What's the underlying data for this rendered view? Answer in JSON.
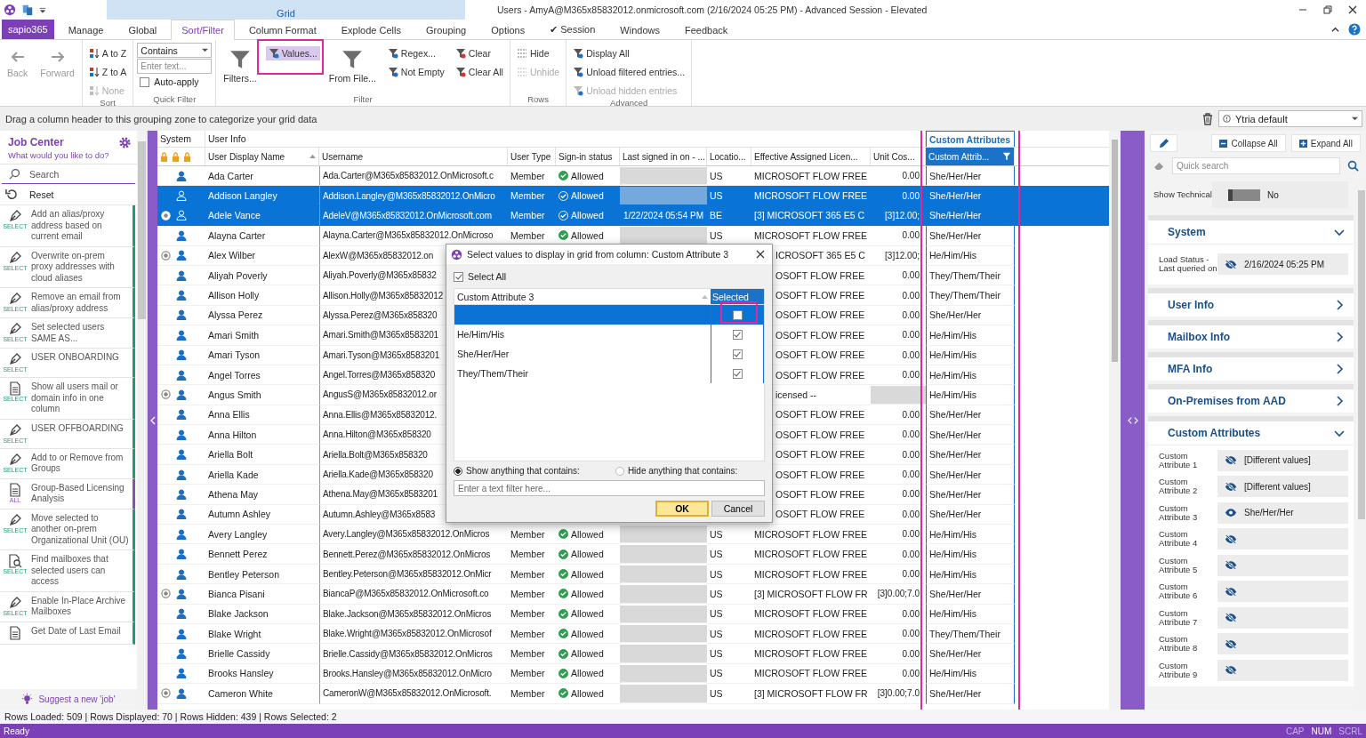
{
  "title_bar": {
    "context_tab": "Grid",
    "title": "Users - AmyA@M365x85832012.onmicrosoft.com (2/16/2024 05:25 PM) - Advanced Session - Elevated"
  },
  "menu": {
    "app_button": "sapio365",
    "tabs": [
      {
        "label": "Manage",
        "selected": false
      },
      {
        "label": "Global",
        "selected": false
      },
      {
        "label": "Sort/Filter",
        "selected": true
      },
      {
        "label": "Column Format",
        "selected": false
      },
      {
        "label": "Explode Cells",
        "selected": false
      },
      {
        "label": "Grouping",
        "selected": false
      },
      {
        "label": "Options",
        "selected": false
      },
      {
        "label": "✔ Session",
        "selected": false
      },
      {
        "label": "Windows",
        "selected": false
      },
      {
        "label": "Feedback",
        "selected": false
      }
    ]
  },
  "ribbon": {
    "groups": [
      {
        "columns": [
          [
            {
              "kind": "large",
              "label": "Back",
              "disabled": true
            }
          ],
          [
            {
              "kind": "large",
              "label": "Forward",
              "disabled": true
            }
          ]
        ]
      },
      {
        "label": "Sort",
        "columns": [
          [
            {
              "kind": "small",
              "label": "A to Z",
              "disabled": false
            },
            {
              "kind": "small",
              "label": "Z to A",
              "disabled": false
            },
            {
              "kind": "small",
              "label": "None",
              "disabled": true
            }
          ]
        ]
      },
      {
        "label": "Quick Filter",
        "columns": [
          [
            {
              "kind": "dropdown",
              "label": "Contains"
            },
            {
              "kind": "input",
              "placeholder": "Enter text..."
            },
            {
              "kind": "checkbox",
              "label": "Auto-apply",
              "checked": false
            }
          ]
        ]
      },
      {
        "label": "Filter",
        "columns": [
          [
            {
              "kind": "large",
              "label": "Filters...",
              "disabled": false
            }
          ],
          [
            {
              "kind": "small",
              "label": "Values...",
              "disabled": false,
              "highlighted": true
            }
          ],
          [
            {
              "kind": "large",
              "label": "From File...",
              "disabled": false
            }
          ],
          [
            {
              "kind": "small",
              "label": "Regex...",
              "disabled": false
            },
            {
              "kind": "small",
              "label": "Not Empty",
              "disabled": false
            }
          ],
          [
            {
              "kind": "small",
              "label": "Clear",
              "disabled": false
            },
            {
              "kind": "small",
              "label": "Clear All",
              "disabled": false
            }
          ]
        ]
      },
      {
        "label": "Rows",
        "columns": [
          [
            {
              "kind": "small",
              "label": "Hide",
              "disabled": false
            },
            {
              "kind": "small",
              "label": "Unhide",
              "disabled": true
            }
          ]
        ]
      },
      {
        "label": "Advanced",
        "columns": [
          [
            {
              "kind": "small",
              "label": "Display All",
              "disabled": false
            },
            {
              "kind": "small",
              "label": "Unload filtered entries...",
              "disabled": false
            },
            {
              "kind": "small",
              "label": "Unload hidden entries",
              "disabled": true
            }
          ]
        ]
      }
    ]
  },
  "grouping_zone": {
    "hint": "Drag a column header to this grouping zone to categorize your grid data",
    "view": "Ytria default"
  },
  "job_center": {
    "title": "Job Center",
    "subtitle": "What would you like to do?",
    "search": "Search",
    "reset": "Reset",
    "suggest": "Suggest a new 'job'",
    "jobs": [
      {
        "kind": "pen",
        "tag": "SELECT",
        "text": "Add an alias/proxy address based on current email",
        "color": "#1e9e6a"
      },
      {
        "kind": "pen",
        "tag": "SELECT",
        "text": "Overwrite on-prem proxy addresses with cloud aliases",
        "color": "#1e9e6a"
      },
      {
        "kind": "pen",
        "tag": "SELECT",
        "text": "Remove an email from alias/proxy address",
        "color": "#1e9e6a"
      },
      {
        "kind": "pen",
        "tag": "SELECT",
        "text": "Set selected users SAME AS...",
        "color": "#1e9e6a"
      },
      {
        "kind": "pen",
        "tag": "SELECT",
        "text": "USER ONBOARDING",
        "color": "#1e9e6a"
      },
      {
        "kind": "doc",
        "tag": "SELECT",
        "text": "Show all users mail or domain info in one column",
        "color": "#1e9e6a"
      },
      {
        "kind": "pen",
        "tag": "SELECT",
        "text": "USER OFFBOARDING",
        "color": "#1e9e6a"
      },
      {
        "kind": "pen",
        "tag": "SELECT",
        "text": "Add to or Remove from Groups",
        "color": "#1e9e6a"
      },
      {
        "kind": "doc",
        "tag": "ALL",
        "text": "Group-Based Licensing Analysis",
        "color": "#8a4cc0"
      },
      {
        "kind": "pen",
        "tag": "SELECT",
        "text": "Move selected to another on-prem Organizational Unit (OU)",
        "color": "#1e9e6a"
      },
      {
        "kind": "find",
        "tag": "SELECT",
        "text": "Find mailboxes that selected users can access",
        "color": "#1e9e6a"
      },
      {
        "kind": "pen",
        "tag": "SELECT",
        "text": "Enable In-Place Archive Mailboxes",
        "color": "#1e9e6a"
      },
      {
        "kind": "doc",
        "text": "Get Date of Last Email",
        "color": "#1e9e6a"
      }
    ]
  },
  "grid": {
    "group_headers": [
      "System",
      "User Info",
      "Custom Attributes"
    ],
    "columns": [
      {
        "label": "User Display Name",
        "sorted": true
      },
      {
        "label": "Username",
        "sorted": false
      },
      {
        "label": "User Type",
        "sorted": false
      },
      {
        "label": "Sign-in status",
        "sorted": false
      },
      {
        "label": "Last signed in on - ...",
        "sorted": false
      },
      {
        "label": "Locatio...",
        "sorted": false
      },
      {
        "label": "Effective Assigned Licen...",
        "sorted": false
      },
      {
        "label": "Unit Cos...",
        "sorted": false
      },
      {
        "label": "Custom Attrib...",
        "sorted": false,
        "filtered": true
      }
    ],
    "rows": [
      {
        "kind": "full",
        "selected": false,
        "flagged": false,
        "name": "Ada Carter",
        "username": "Ada.Carter@M365x85832012.OnMicrosoft.c",
        "user_type": "Member",
        "sign_in": "Allowed",
        "location": "US",
        "license": "MICROSOFT FLOW FREE",
        "unit_cost": "0.00",
        "custom_attribute": "She/Her/Her"
      },
      {
        "kind": "full",
        "selected": true,
        "flagged": false,
        "name": "Addison Langley",
        "username": "Addison.Langley@M365x85832012.OnMicro",
        "user_type": "Member",
        "sign_in": "Allowed",
        "location": "US",
        "license": "MICROSOFT FLOW FREE",
        "unit_cost": "0.00",
        "custom_attribute": "She/Her/Her"
      },
      {
        "kind": "full",
        "selected": true,
        "flagged": true,
        "name": "Adele Vance",
        "username": "AdeleV@M365x85832012.OnMicrosoft.com",
        "user_type": "Member",
        "sign_in": "Allowed",
        "last_signed": "1/22/2024 05:54 PM",
        "location": "BE",
        "license": "[3] MICROSOFT 365 E5 C",
        "unit_cost": "[3]12.00;",
        "custom_attribute": "She/Her/Her"
      },
      {
        "kind": "full",
        "selected": false,
        "flagged": false,
        "name": "Alayna Carter",
        "username": "Alayna.Carter@M365x85832012.OnMicroso",
        "user_type": "Member",
        "sign_in": "Allowed",
        "location": "US",
        "license": "MICROSOFT FLOW FREE",
        "unit_cost": "0.00",
        "custom_attribute": "She/Her/Her"
      },
      {
        "kind": "covered",
        "selected": false,
        "flagged": true,
        "name": "Alex Wilber",
        "username": "AlexW@M365x85832012.on",
        "license": "ICROSOFT 365 E5 C",
        "unit_cost": "[3]12.00;",
        "custom_attribute": "He/Him/His"
      },
      {
        "kind": "covered",
        "selected": false,
        "flagged": false,
        "name": "Aliyah Poverly",
        "username": "Aliyah.Poverly@M365x85832",
        "license": "OSOFT FLOW FREE",
        "unit_cost": "0.00",
        "custom_attribute": "They/Them/Their"
      },
      {
        "kind": "covered",
        "selected": false,
        "flagged": false,
        "name": "Allison Holly",
        "username": "Allison.Holly@M365x85832012",
        "license": "OSOFT FLOW FREE",
        "unit_cost": "0.00",
        "custom_attribute": "They/Them/Their"
      },
      {
        "kind": "covered",
        "selected": false,
        "flagged": false,
        "name": "Alyssa Perez",
        "username": "Alyssa.Perez@M365x858320",
        "license": "OSOFT FLOW FREE",
        "unit_cost": "0.00",
        "custom_attribute": "She/Her/Her"
      },
      {
        "kind": "covered",
        "selected": false,
        "flagged": false,
        "name": "Amari Smith",
        "username": "Amari.Smith@M365x8583201",
        "license": "OSOFT FLOW FREE",
        "unit_cost": "0.00",
        "custom_attribute": "He/Him/His"
      },
      {
        "kind": "covered",
        "selected": false,
        "flagged": false,
        "name": "Amari Tyson",
        "username": "Amari.Tyson@M365x8583201",
        "license": "OSOFT FLOW FREE",
        "unit_cost": "0.00",
        "custom_attribute": "He/Him/His"
      },
      {
        "kind": "covered",
        "selected": false,
        "flagged": false,
        "name": "Angel Torres",
        "username": "Angel.Torres@M365x858320",
        "license": "OSOFT FLOW FREE",
        "unit_cost": "0.00",
        "custom_attribute": "He/Him/His"
      },
      {
        "kind": "covered",
        "selected": false,
        "flagged": true,
        "name": "Angus Smith",
        "username": "AngusS@M365x85832012.or",
        "license": "icensed --",
        "custom_attribute": "He/Him/His"
      },
      {
        "kind": "covered",
        "selected": false,
        "flagged": false,
        "name": "Anna Ellis",
        "username": "Anna.Ellis@M365x85832012.",
        "license": "OSOFT FLOW FREE",
        "unit_cost": "0.00",
        "custom_attribute": "She/Her/Her"
      },
      {
        "kind": "covered",
        "selected": false,
        "flagged": false,
        "name": "Anna Hilton",
        "username": "Anna.Hilton@M365x858320",
        "license": "OSOFT FLOW FREE",
        "unit_cost": "0.00",
        "custom_attribute": "She/Her/Her"
      },
      {
        "kind": "covered",
        "selected": false,
        "flagged": false,
        "name": "Ariella Bolt",
        "username": "Ariella.Bolt@M365x858320",
        "license": "OSOFT FLOW FREE",
        "unit_cost": "0.00",
        "custom_attribute": "She/Her/Her"
      },
      {
        "kind": "covered",
        "selected": false,
        "flagged": false,
        "name": "Ariella Kade",
        "username": "Ariella.Kade@M365x858320",
        "license": "OSOFT FLOW FREE",
        "unit_cost": "0.00",
        "custom_attribute": "She/Her/Her"
      },
      {
        "kind": "covered",
        "selected": false,
        "flagged": false,
        "name": "Athena May",
        "username": "Athena.May@M365x8583201",
        "license": "OSOFT FLOW FREE",
        "unit_cost": "0.00",
        "custom_attribute": "She/Her/Her"
      },
      {
        "kind": "covered",
        "selected": false,
        "flagged": false,
        "name": "Autumn Ashley",
        "username": "Autumn.Ashley@M365x8583",
        "license": "OSOFT FLOW FREE",
        "unit_cost": "0.00",
        "custom_attribute": "She/Her/Her"
      },
      {
        "kind": "full",
        "selected": false,
        "flagged": false,
        "name": "Avery Langley",
        "username": "Avery.Langley@M365x85832012.OnMicros",
        "user_type": "Member",
        "sign_in": "Allowed",
        "location": "US",
        "license": "MICROSOFT FLOW FREE",
        "unit_cost": "0.00",
        "custom_attribute": "He/Him/His"
      },
      {
        "kind": "full",
        "selected": false,
        "flagged": false,
        "name": "Bennett Perez",
        "username": "Bennett.Perez@M365x85832012.OnMicros",
        "user_type": "Member",
        "sign_in": "Allowed",
        "location": "US",
        "license": "MICROSOFT FLOW FREE",
        "unit_cost": "0.00",
        "custom_attribute": "He/Him/His"
      },
      {
        "kind": "full",
        "selected": false,
        "flagged": false,
        "name": "Bentley Peterson",
        "username": "Bentley.Peterson@M365x85832012.OnMicr",
        "user_type": "Member",
        "sign_in": "Allowed",
        "location": "US",
        "license": "MICROSOFT FLOW FREE",
        "unit_cost": "0.00",
        "custom_attribute": "He/Him/His"
      },
      {
        "kind": "full",
        "selected": false,
        "flagged": true,
        "name": "Bianca Pisani",
        "username": "BiancaP@M365x85832012.OnMicrosoft.co",
        "user_type": "Member",
        "sign_in": "Allowed",
        "location": "US",
        "license": "[3] MICROSOFT FLOW FR",
        "unit_cost": "[3]0.00;7.0",
        "custom_attribute": "She/Her/Her"
      },
      {
        "kind": "full",
        "selected": false,
        "flagged": false,
        "name": "Blake Jackson",
        "username": "Blake.Jackson@M365x85832012.OnMicros",
        "user_type": "Member",
        "sign_in": "Allowed",
        "location": "US",
        "license": "MICROSOFT FLOW FREE",
        "unit_cost": "0.00",
        "custom_attribute": "He/Him/His"
      },
      {
        "kind": "full",
        "selected": false,
        "flagged": false,
        "name": "Blake Wright",
        "username": "Blake.Wright@M365x85832012.OnMicrosof",
        "user_type": "Member",
        "sign_in": "Allowed",
        "location": "US",
        "license": "MICROSOFT FLOW FREE",
        "unit_cost": "0.00",
        "custom_attribute": "They/Them/Their"
      },
      {
        "kind": "full",
        "selected": false,
        "flagged": false,
        "name": "Brielle Cassidy",
        "username": "Brielle.Cassidy@M365x85832012.OnMicros",
        "user_type": "Member",
        "sign_in": "Allowed",
        "location": "US",
        "license": "MICROSOFT FLOW FREE",
        "unit_cost": "0.00",
        "custom_attribute": "She/Her/Her"
      },
      {
        "kind": "full",
        "selected": false,
        "flagged": false,
        "name": "Brooks Hansley",
        "username": "Brooks.Hansley@M365x85832012.OnMicro",
        "user_type": "Member",
        "sign_in": "Allowed",
        "location": "US",
        "license": "MICROSOFT FLOW FREE",
        "unit_cost": "0.00",
        "custom_attribute": "He/Him/His"
      },
      {
        "kind": "full",
        "selected": false,
        "flagged": true,
        "name": "Cameron White",
        "username": "CameronW@M365x85832012.OnMicrosoft.",
        "user_type": "Member",
        "sign_in": "Allowed",
        "location": "US",
        "license": "[3] MICROSOFT FLOW FR",
        "unit_cost": "[3]0.00;7.0",
        "custom_attribute": "She/Her/Her"
      }
    ]
  },
  "dialog": {
    "title": "Select values to display in grid from column: Custom Attribute 3",
    "select_all": {
      "label": "Select All",
      "checked": true
    },
    "columns": [
      "Custom Attribute 3",
      "Selected"
    ],
    "values": [
      {
        "selected": true,
        "checked": false
      },
      {
        "value": "He/Him/His",
        "selected": false,
        "checked": true
      },
      {
        "value": "She/Her/Her",
        "selected": false,
        "checked": true
      },
      {
        "value": "They/Them/Their",
        "selected": false,
        "checked": true
      }
    ],
    "options": [
      {
        "label": "Show anything that contains:",
        "selected": true
      },
      {
        "label": "Hide anything that contains:",
        "selected": false
      }
    ],
    "filter_placeholder": "Enter a text filter here...",
    "buttons": [
      {
        "label": "OK",
        "kind": "default"
      },
      {
        "label": "Cancel",
        "kind": "normal"
      }
    ]
  },
  "properties": {
    "collapse": "Collapse All",
    "expand": "Expand All",
    "search_placeholder": "Quick search",
    "show_technical": {
      "label": "Show Technical",
      "value": "No",
      "on": false
    },
    "sections": [
      {
        "title": "System",
        "expanded": true,
        "fields": [
          {
            "label": "Load Status - Last queried on",
            "value": "2/16/2024 05:25 PM",
            "visible": false
          }
        ]
      },
      {
        "title": "User Info",
        "expanded": false
      },
      {
        "title": "Mailbox Info",
        "expanded": false
      },
      {
        "title": "MFA Info",
        "expanded": false
      },
      {
        "title": "On-Premises from AAD",
        "expanded": false
      },
      {
        "title": "Custom Attributes",
        "expanded": true,
        "fields": [
          {
            "label": "Custom Attribute 1",
            "value": "[Different values]",
            "visible": false
          },
          {
            "label": "Custom Attribute 2",
            "value": "[Different values]",
            "visible": false
          },
          {
            "label": "Custom Attribute 3",
            "value": "She/Her/Her",
            "visible": true
          },
          {
            "label": "Custom Attribute 4",
            "visible": false
          },
          {
            "label": "Custom Attribute 5",
            "visible": false
          },
          {
            "label": "Custom Attribute 6",
            "visible": false
          },
          {
            "label": "Custom Attribute 7",
            "visible": false
          },
          {
            "label": "Custom Attribute 8",
            "visible": false
          },
          {
            "label": "Custom Attribute 9",
            "visible": false
          }
        ]
      }
    ]
  },
  "rows_info": "Rows Loaded: 509 | Rows Displayed: 70 | Rows Hidden: 439 | Rows Selected: 2",
  "status_bar": {
    "text": "Ready",
    "indicators": [
      {
        "label": "CAP",
        "on": false
      },
      {
        "label": "NUM",
        "on": true
      },
      {
        "label": "SCRL",
        "on": false
      }
    ]
  }
}
